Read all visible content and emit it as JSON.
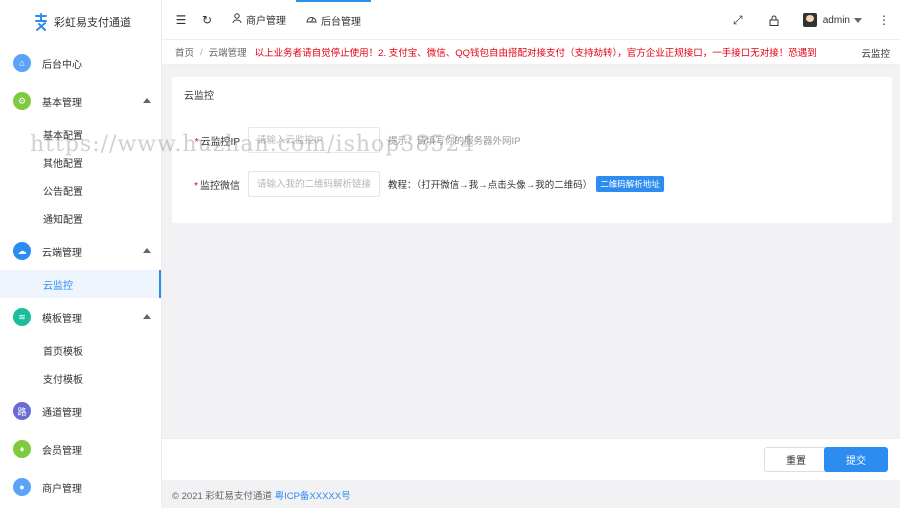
{
  "sidebar": {
    "logo_text": "彩虹易支付通道",
    "menu": [
      {
        "label": "后台中心",
        "icon": "home-icon",
        "color": "#5aa3f8"
      },
      {
        "label": "基本管理",
        "icon": "gear-icon",
        "color": "#7fcb3f",
        "sub": [
          "基本配置",
          "其他配置",
          "公告配置",
          "通知配置"
        ]
      },
      {
        "label": "云端管理",
        "icon": "cloud-icon",
        "color": "#2d8cf0",
        "sub": [
          "云监控"
        ]
      },
      {
        "label": "模板管理",
        "icon": "layers-icon",
        "color": "#19be9b",
        "sub": [
          "首页模板",
          "支付模板"
        ]
      },
      {
        "label": "通道管理",
        "icon": "channel-icon",
        "color": "#6b6bd6"
      },
      {
        "label": "会员管理",
        "icon": "member-icon",
        "color": "#7fcb3f"
      },
      {
        "label": "商户管理",
        "icon": "merchant-icon",
        "color": "#5aa3f8"
      }
    ],
    "active_sub": "云监控"
  },
  "topbar": {
    "tabs": [
      {
        "label": "商户管理",
        "icon": "user-icon"
      },
      {
        "label": "后台管理",
        "icon": "dashboard-icon",
        "active": true
      }
    ],
    "admin_name": "admin"
  },
  "breadcrumb": {
    "home": "首页",
    "section": "云端管理",
    "notice": "以上业务者请自觉停止使用！2. 支付宝、微信、QQ钱包自由搭配对接支付（支持劫转），官方企业正规接口，一手接口无对接！恐遇到",
    "current": "云监控"
  },
  "card": {
    "title": "云监控",
    "fields": [
      {
        "label": "云监控IP",
        "required": true,
        "placeholder": "请输入云监控IP",
        "hint": "提示：请填写你的服务器外网IP"
      },
      {
        "label": "监控微信",
        "required": true,
        "placeholder": "请输入我的二维码解析链接",
        "tutorial": "教程：（打开微信→我→点击头像→我的二维码）",
        "button": "二维码解析地址"
      }
    ]
  },
  "actions": {
    "reset": "重置",
    "submit": "提交"
  },
  "footer": {
    "copyright": "© 2021 彩虹易支付通道",
    "icp": "粤ICP备XXXXX号"
  },
  "watermark": "https://www.huzhan.com/ishop38524"
}
